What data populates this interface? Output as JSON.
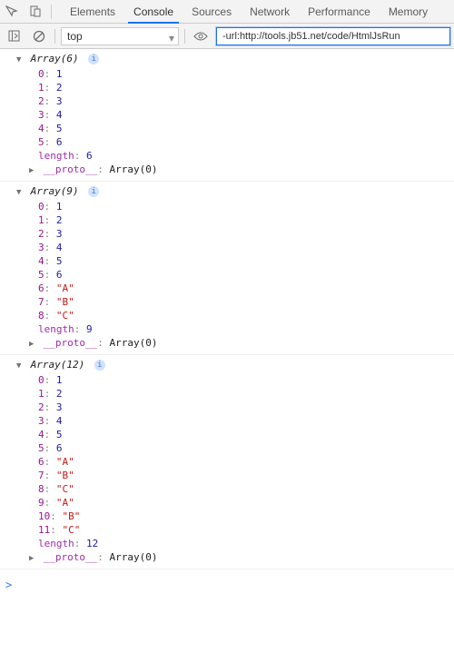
{
  "tabs": [
    "Elements",
    "Console",
    "Sources",
    "Network",
    "Performance",
    "Memory"
  ],
  "active_tab": "Console",
  "context": "top",
  "filter_value": "-url:http://tools.jb51.net/code/HtmlJsRun",
  "blocks": [
    {
      "header": "Array(6)",
      "items": [
        {
          "k": "0",
          "v": "1",
          "t": "num"
        },
        {
          "k": "1",
          "v": "2",
          "t": "num"
        },
        {
          "k": "2",
          "v": "3",
          "t": "num"
        },
        {
          "k": "3",
          "v": "4",
          "t": "num"
        },
        {
          "k": "4",
          "v": "5",
          "t": "num"
        },
        {
          "k": "5",
          "v": "6",
          "t": "num"
        }
      ],
      "length": "6",
      "proto": "Array(0)"
    },
    {
      "header": "Array(9)",
      "items": [
        {
          "k": "0",
          "v": "1",
          "t": "num"
        },
        {
          "k": "1",
          "v": "2",
          "t": "num"
        },
        {
          "k": "2",
          "v": "3",
          "t": "num"
        },
        {
          "k": "3",
          "v": "4",
          "t": "num"
        },
        {
          "k": "4",
          "v": "5",
          "t": "num"
        },
        {
          "k": "5",
          "v": "6",
          "t": "num"
        },
        {
          "k": "6",
          "v": "\"A\"",
          "t": "str"
        },
        {
          "k": "7",
          "v": "\"B\"",
          "t": "str"
        },
        {
          "k": "8",
          "v": "\"C\"",
          "t": "str"
        }
      ],
      "length": "9",
      "proto": "Array(0)"
    },
    {
      "header": "Array(12)",
      "items": [
        {
          "k": "0",
          "v": "1",
          "t": "num"
        },
        {
          "k": "1",
          "v": "2",
          "t": "num"
        },
        {
          "k": "2",
          "v": "3",
          "t": "num"
        },
        {
          "k": "3",
          "v": "4",
          "t": "num"
        },
        {
          "k": "4",
          "v": "5",
          "t": "num"
        },
        {
          "k": "5",
          "v": "6",
          "t": "num"
        },
        {
          "k": "6",
          "v": "\"A\"",
          "t": "str"
        },
        {
          "k": "7",
          "v": "\"B\"",
          "t": "str"
        },
        {
          "k": "8",
          "v": "\"C\"",
          "t": "str"
        },
        {
          "k": "9",
          "v": "\"A\"",
          "t": "str"
        },
        {
          "k": "10",
          "v": "\"B\"",
          "t": "str"
        },
        {
          "k": "11",
          "v": "\"C\"",
          "t": "str"
        }
      ],
      "length": "12",
      "proto": "Array(0)"
    }
  ],
  "length_key": "length",
  "proto_key": "__proto__",
  "prompt": ">"
}
